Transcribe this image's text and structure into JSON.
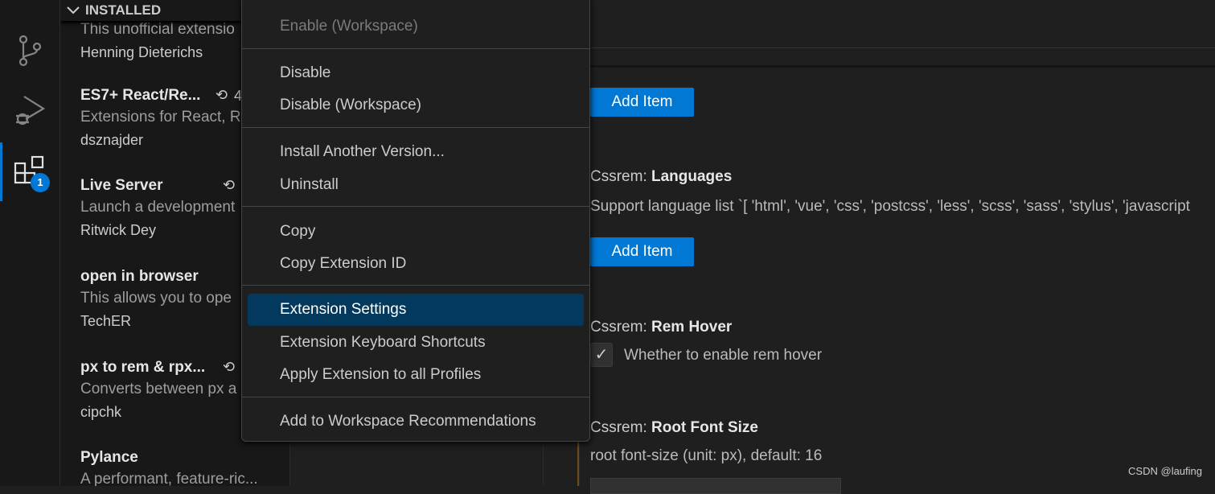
{
  "activity_bar": {
    "extensions_badge": "1",
    "accent": "#0078d4"
  },
  "sidebar": {
    "section_title": "INSTALLED",
    "extensions": [
      {
        "name": "",
        "description": "This unofficial extensio",
        "publisher": "Henning Dieterichs"
      },
      {
        "name": "ES7+ React/Re...",
        "description": "Extensions for React, R",
        "publisher": "dsznajder",
        "history_count": "4"
      },
      {
        "name": "Live Server",
        "description": "Launch a development",
        "publisher": "Ritwick Dey"
      },
      {
        "name": "open in browser",
        "description": "This allows you to ope",
        "publisher": "TechER"
      },
      {
        "name": "px to rem & rpx...",
        "description": "Converts between px a",
        "publisher": "cipchk"
      },
      {
        "name": "Pylance",
        "description": "A performant, feature-ric..."
      }
    ]
  },
  "context_menu": {
    "items": [
      {
        "label": "Enable (Workspace)",
        "disabled": true
      },
      {
        "label": "Disable"
      },
      {
        "label": "Disable (Workspace)"
      },
      {
        "label": "Install Another Version..."
      },
      {
        "label": "Uninstall"
      },
      {
        "label": "Copy"
      },
      {
        "label": "Copy Extension ID"
      },
      {
        "label": "Extension Settings",
        "selected": true
      },
      {
        "label": "Extension Keyboard Shortcuts"
      },
      {
        "label": "Apply Extension to all Profiles"
      },
      {
        "label": "Add to Workspace Recommendations"
      }
    ]
  },
  "settings": {
    "add_item_label": "Add Item",
    "prefix": "Cssrem: ",
    "languages": {
      "title": "Languages",
      "description": "Support language list `[ 'html', 'vue', 'css', 'postcss', 'less', 'scss', 'sass', 'stylus', 'javascript"
    },
    "rem_hover": {
      "title": "Rem Hover",
      "description": "Whether to enable rem hover",
      "checked": true
    },
    "root_font_size": {
      "title": "Root Font Size",
      "description": "root font-size (unit: px), default: 16"
    }
  },
  "watermark": "CSDN @laufing"
}
